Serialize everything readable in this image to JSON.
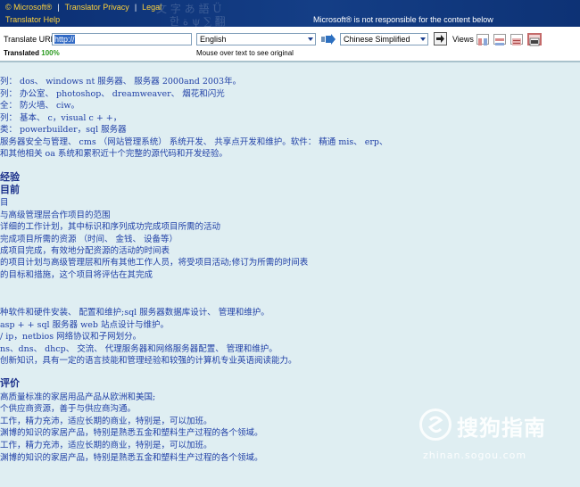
{
  "header": {
    "brand": "© Microsoft®",
    "links": [
      "Translator Privacy",
      "Legal"
    ],
    "help": "Translator Help",
    "disclaimer": "Microsoft® is not responsible for the content below",
    "bg_color": "#0b2f73",
    "link_color": "#ffd23a"
  },
  "toolbar": {
    "url_label": "Translate URL",
    "url_value": "http://",
    "from_language": "English",
    "to_language": "Chinese Simplified",
    "views_label": "Views",
    "translated_label": "Translated",
    "translated_percent": "100%",
    "mouseover_hint": "Mouse over text to see original",
    "icons": [
      "swap-arrow-icon",
      "go-arrow-icon",
      "view-side-by-side-icon",
      "view-top-bottom-icon",
      "view-original-icon",
      "view-translation-icon"
    ]
  },
  "content": {
    "text_color": "#1f3fa6",
    "lines": [
      "列： dos、 windows nt 服务器、 服务器 2000and 2003年。",
      "列： 办公室、 photoshop、 dreamweaver、 烟花和闪光",
      "全： 防火墙、 ciw。",
      "列： 基本、 c，visual c + +，",
      "类： powerbuilder，sql 服务器",
      "服务器安全与管理、 cms （网站管理系统） 系统开发、 共享点开发和维护。软件： 精通 mis、 erp、",
      "和其他相关 oa 系统和累积近十个完整的源代码和开发经验。",
      "经验",
      "目前",
      "目",
      "与高级管理层合作项目的范围",
      "详细的工作计划，其中标识和序列成功完成项目所需的活动",
      "完成项目所需的资源 （时间、 金钱、 设备等）",
      "成项目完成，有效地分配资源的活动的时间表",
      "的项目计划与高级管理层和所有其他工作人员，将受项目活动;修订为所需的时间表",
      "的目标和措施，这个项目将评估在其完成",
      "种软件和硬件安装、 配置和维护;sql 服务器数据库设计、 管理和维护。",
      "asp + + sql 服务器 web 站点设计与维护。",
      "/ ip，netbios 网络协议和子网划分。",
      "ns、dns、 dhcp、 交流、 代理服务器和网络服务器配置、 管理和维护。",
      "创新知识，具有一定的语言技能和管理经验和较强的计算机专业英语阅读能力。",
      "评价",
      "高质量标准的家居用品产品从欧洲和美国;",
      "个供应商资源，善于与供应商沟通。",
      "工作，精力充沛，适应长期的商业，特别是，可以加班。",
      "渊博的知识的家居产品，特别是熟悉五金和塑料生产过程的各个领域。",
      "工作，精力充沛，适应长期的商业，特别是，可以加班。",
      "渊博的知识的家居产品，特别是熟悉五金和塑料生产过程的各个领域。"
    ]
  },
  "watermark": {
    "title": "搜狗指南",
    "subtitle": "zhinan.sogou.com"
  }
}
